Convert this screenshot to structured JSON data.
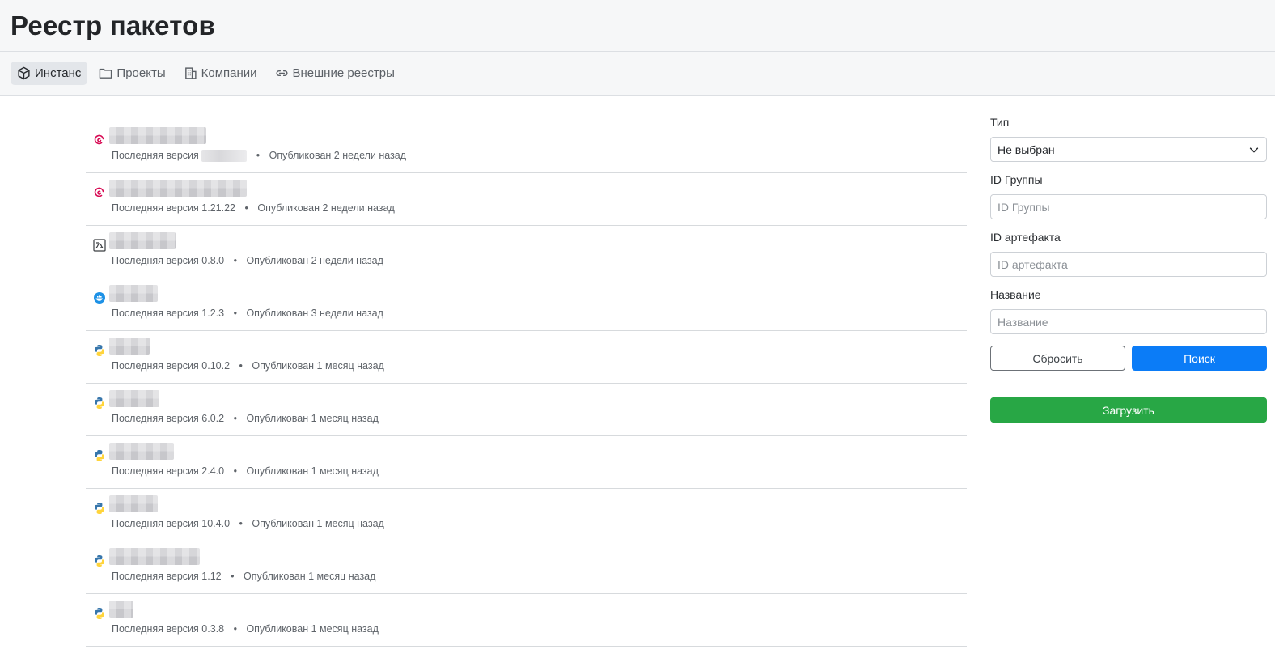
{
  "header": {
    "title": "Реестр пакетов"
  },
  "tabs": [
    {
      "label": "Инстанс",
      "icon": "box-icon",
      "active": true
    },
    {
      "label": "Проекты",
      "icon": "folder-icon",
      "active": false
    },
    {
      "label": "Компании",
      "icon": "building-icon",
      "active": false
    },
    {
      "label": "Внешние реестры",
      "icon": "link-icon",
      "active": false
    }
  ],
  "packages": [
    {
      "icon": "debian-icon",
      "version_label": "Последняя версия",
      "version": "",
      "published": "Опубликован 2 недели назад"
    },
    {
      "icon": "debian-icon",
      "version_label": "Последняя версия",
      "version": "1.21.22",
      "published": "Опубликован 2 недели назад"
    },
    {
      "icon": "helm-icon",
      "version_label": "Последняя версия",
      "version": "0.8.0",
      "published": "Опубликован 2 недели назад"
    },
    {
      "icon": "docker-icon",
      "version_label": "Последняя версия",
      "version": "1.2.3",
      "published": "Опубликован 3 недели назад"
    },
    {
      "icon": "python-icon",
      "version_label": "Последняя версия",
      "version": "0.10.2",
      "published": "Опубликован 1 месяц назад"
    },
    {
      "icon": "python-icon",
      "version_label": "Последняя версия",
      "version": "6.0.2",
      "published": "Опубликован 1 месяц назад"
    },
    {
      "icon": "python-icon",
      "version_label": "Последняя версия",
      "version": "2.4.0",
      "published": "Опубликован 1 месяц назад"
    },
    {
      "icon": "python-icon",
      "version_label": "Последняя версия",
      "version": "10.4.0",
      "published": "Опубликован 1 месяц назад"
    },
    {
      "icon": "python-icon",
      "version_label": "Последняя версия",
      "version": "1.12",
      "published": "Опубликован 1 месяц назад"
    },
    {
      "icon": "python-icon",
      "version_label": "Последняя версия",
      "version": "0.3.8",
      "published": "Опубликован 1 месяц назад"
    }
  ],
  "filters": {
    "type": {
      "label": "Тип",
      "selected": "Не выбран"
    },
    "group_id": {
      "label": "ID Группы",
      "placeholder": "ID Группы"
    },
    "artifact_id": {
      "label": "ID артефакта",
      "placeholder": "ID артефакта"
    },
    "name": {
      "label": "Название",
      "placeholder": "Название"
    },
    "reset_label": "Сбросить",
    "search_label": "Поиск",
    "upload_label": "Загрузить"
  },
  "colors": {
    "primary": "#0b7cf7",
    "success": "#28a745",
    "debian": "#d70a53",
    "docker": "#1d91e6",
    "python_blue": "#3776ab",
    "python_yellow": "#ffd43b"
  }
}
